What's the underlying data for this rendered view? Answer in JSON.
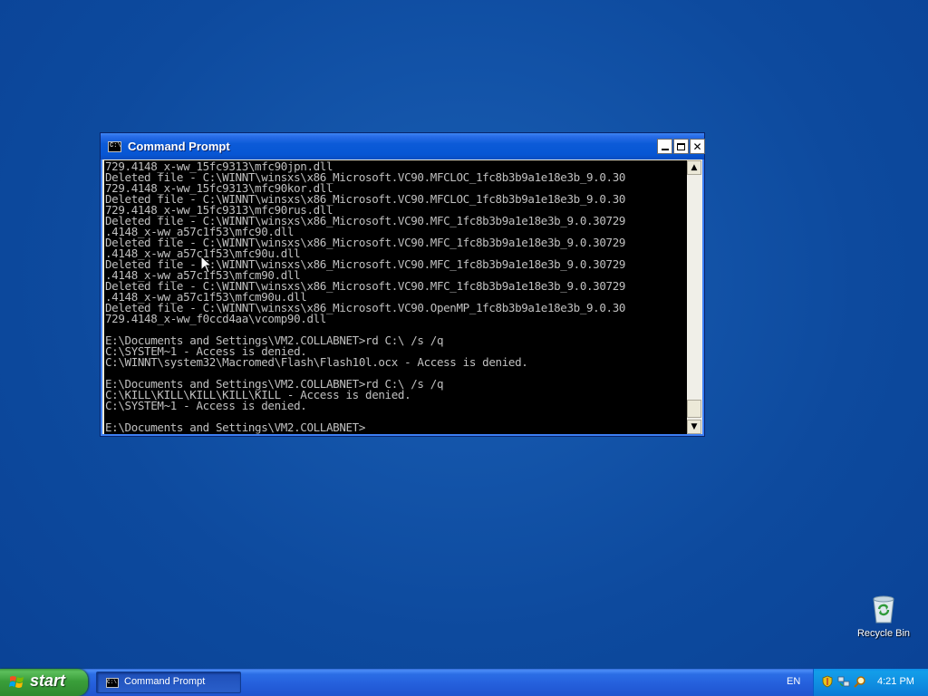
{
  "window": {
    "title": "Command Prompt",
    "icon": "cmd-icon",
    "console_text": "729.4148_x-ww_15fc9313\\mfc90jpn.dll\nDeleted file - C:\\WINNT\\winsxs\\x86_Microsoft.VC90.MFCLOC_1fc8b3b9a1e18e3b_9.0.30\n729.4148_x-ww_15fc9313\\mfc90kor.dll\nDeleted file - C:\\WINNT\\winsxs\\x86_Microsoft.VC90.MFCLOC_1fc8b3b9a1e18e3b_9.0.30\n729.4148_x-ww_15fc9313\\mfc90rus.dll\nDeleted file - C:\\WINNT\\winsxs\\x86_Microsoft.VC90.MFC_1fc8b3b9a1e18e3b_9.0.30729\n.4148_x-ww_a57c1f53\\mfc90.dll\nDeleted file - C:\\WINNT\\winsxs\\x86_Microsoft.VC90.MFC_1fc8b3b9a1e18e3b_9.0.30729\n.4148_x-ww_a57c1f53\\mfc90u.dll\nDeleted file - C:\\WINNT\\winsxs\\x86_Microsoft.VC90.MFC_1fc8b3b9a1e18e3b_9.0.30729\n.4148_x-ww_a57c1f53\\mfcm90.dll\nDeleted file - C:\\WINNT\\winsxs\\x86_Microsoft.VC90.MFC_1fc8b3b9a1e18e3b_9.0.30729\n.4148_x-ww_a57c1f53\\mfcm90u.dll\nDeleted file - C:\\WINNT\\winsxs\\x86_Microsoft.VC90.OpenMP_1fc8b3b9a1e18e3b_9.0.30\n729.4148_x-ww_f0ccd4aa\\vcomp90.dll\n\nE:\\Documents and Settings\\VM2.COLLABNET>rd C:\\ /s /q\nC:\\SYSTEM~1 - Access is denied.\nC:\\WINNT\\system32\\Macromed\\Flash\\Flash10l.ocx - Access is denied.\n\nE:\\Documents and Settings\\VM2.COLLABNET>rd C:\\ /s /q\nC:\\KILL\\KILL\\KILL\\KILL\\KILL - Access is denied.\nC:\\SYSTEM~1 - Access is denied.\n\nE:\\Documents and Settings\\VM2.COLLABNET>"
  },
  "desktop": {
    "icons": [
      {
        "label": "Recycle Bin",
        "icon": "recycle-bin-icon"
      }
    ]
  },
  "taskbar": {
    "start_label": "start",
    "tasks": [
      {
        "label": "Command Prompt",
        "icon": "cmd-icon"
      }
    ],
    "language": "EN",
    "tray_icons": [
      "security-shield-icon",
      "network-icon",
      "search-icon"
    ],
    "clock": "4:21 PM"
  },
  "colors": {
    "desktop": "#0d4a9e",
    "titlebar": "#0756d4",
    "console_bg": "#000000",
    "console_fg": "#c0c0c0",
    "start_button": "#3a9e3a"
  }
}
